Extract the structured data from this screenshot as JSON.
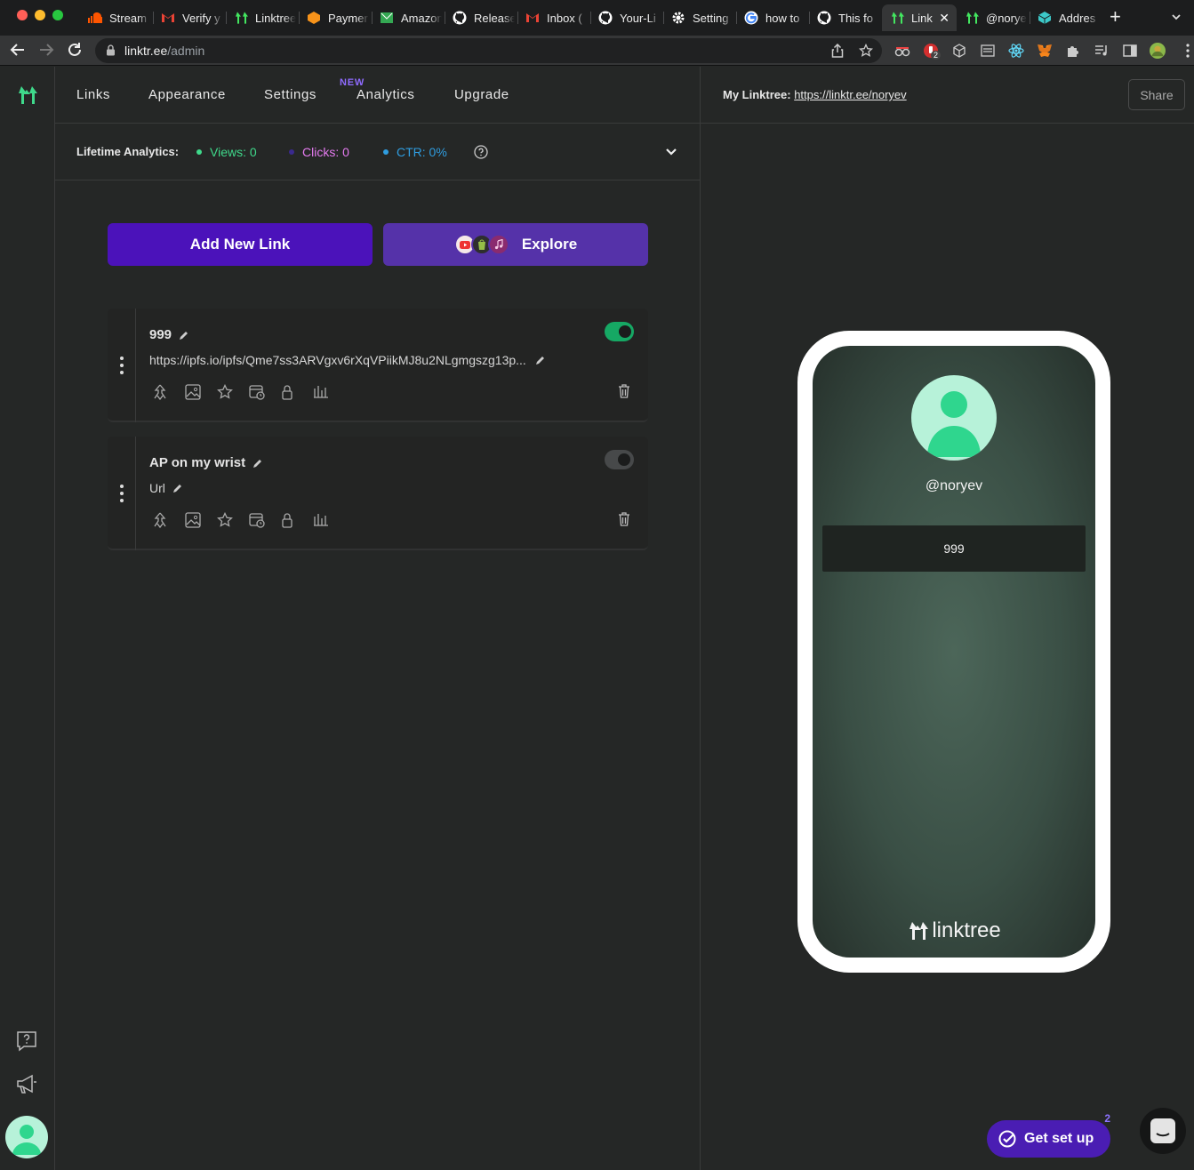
{
  "browser": {
    "tabs": [
      {
        "title": "Stream",
        "icon": "soundcloud-icon",
        "color": "#ff5500"
      },
      {
        "title": "Verify y",
        "icon": "gmail-icon",
        "color": "#ea4335"
      },
      {
        "title": "Linktree",
        "icon": "linktree-icon",
        "color": "#43e660"
      },
      {
        "title": "Paymer",
        "icon": "box-icon",
        "color": "#f7931a"
      },
      {
        "title": "Amazon",
        "icon": "mail-icon",
        "color": "#34a853"
      },
      {
        "title": "Release",
        "icon": "github-icon",
        "color": "#ffffff"
      },
      {
        "title": "Inbox (",
        "icon": "gmail-icon",
        "color": "#ea4335"
      },
      {
        "title": "Your-Li",
        "icon": "github-icon",
        "color": "#ffffff"
      },
      {
        "title": "Setting",
        "icon": "gear-icon",
        "color": "#ffffff"
      },
      {
        "title": "how to",
        "icon": "google-icon",
        "color": "#4285f4"
      },
      {
        "title": "This fo",
        "icon": "github-icon",
        "color": "#ffffff"
      },
      {
        "title": "Link",
        "icon": "linktree-icon",
        "color": "#43e660",
        "active": true
      },
      {
        "title": "@norye",
        "icon": "linktree-icon",
        "color": "#43e660"
      },
      {
        "title": "Addres",
        "icon": "cube-icon",
        "color": "#3cc8c8"
      }
    ],
    "url_host": "linktr.ee",
    "url_path": "/admin",
    "extension_badge": "2"
  },
  "nav": {
    "tabs": [
      "Links",
      "Appearance",
      "Settings",
      "Analytics",
      "Upgrade"
    ],
    "new_badge": "NEW"
  },
  "analytics": {
    "label": "Lifetime Analytics:",
    "views": "Views: 0",
    "clicks": "Clicks: 0",
    "ctr": "CTR: 0%",
    "colors": {
      "views": "#3fd98b",
      "clicks": "#e57bf0",
      "ctr": "#2f9de0"
    }
  },
  "actions": {
    "add_link": "Add New Link",
    "explore": "Explore"
  },
  "links": [
    {
      "title": "999",
      "url": "https://ipfs.io/ipfs/Qme7ss3ARVgxv6rXqVPiikMJ8u2NLgmgszg13p...",
      "enabled": true
    },
    {
      "title": "AP on my wrist",
      "url": "Url",
      "enabled": false
    }
  ],
  "preview": {
    "label": "My Linktree:",
    "url": "https://linktr.ee/noryev",
    "share": "Share",
    "handle": "@noryev",
    "link_button": "999",
    "brand": "linktree"
  },
  "helpers": {
    "get_set_up": "Get set up",
    "get_set_up_count": "2"
  },
  "colors": {
    "accent_green": "#3fd98b",
    "toggle_on": "#16a864",
    "primary_purple": "#4b12ba"
  }
}
